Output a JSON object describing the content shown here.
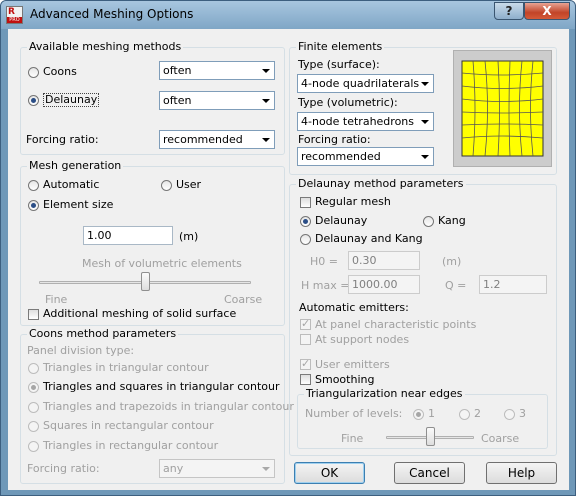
{
  "window": {
    "title": "Advanced Meshing Options",
    "help_button": "?",
    "close_button": "X"
  },
  "app_icon": {
    "letter": "R",
    "brand": "PRO"
  },
  "meshing_methods": {
    "legend": "Available meshing methods",
    "coons": {
      "label": "Coons",
      "selected": false,
      "value": "often"
    },
    "delaunay": {
      "label": "Delaunay",
      "selected": true,
      "value": "often"
    },
    "forcing_ratio": {
      "label": "Forcing ratio:",
      "value": "recommended"
    }
  },
  "finite_elements": {
    "legend": "Finite elements",
    "surface_label": "Type (surface):",
    "surface_value": "4-node quadrilaterals",
    "volumetric_label": "Type (volumetric):",
    "volumetric_value": "4-node tetrahedrons",
    "forcing_label": "Forcing ratio:",
    "forcing_value": "recommended",
    "preview": {
      "fill_color": "#ffff00",
      "background": "#cccccc"
    }
  },
  "mesh_generation": {
    "legend": "Mesh generation",
    "automatic": {
      "label": "Automatic",
      "selected": false
    },
    "user": {
      "label": "User",
      "selected": false
    },
    "element_size": {
      "label": "Element size",
      "selected": true
    },
    "size_value": "1.00",
    "size_unit": "(m)",
    "volumetric_label": "Mesh of volumetric elements",
    "fine_label": "Fine",
    "coarse_label": "Coarse",
    "slider_level": 0.5,
    "additional": {
      "label": "Additional meshing of solid surface",
      "checked": false
    }
  },
  "coons_params": {
    "legend": "Coons method parameters",
    "division_label": "Panel division type:",
    "options": [
      {
        "label": "Triangles in triangular contour",
        "selected": false
      },
      {
        "label": "Triangles and squares in triangular contour",
        "selected": true
      },
      {
        "label": "Triangles and trapezoids in triangular contour",
        "selected": false
      },
      {
        "label": "Squares in rectangular contour",
        "selected": false
      },
      {
        "label": "Triangles in rectangular contour",
        "selected": false
      }
    ],
    "forcing_label": "Forcing ratio:",
    "forcing_value": "any"
  },
  "delaunay_params": {
    "legend": "Delaunay method parameters",
    "regular_mesh": {
      "label": "Regular mesh",
      "checked": false
    },
    "delaunay": {
      "label": "Delaunay",
      "selected": true
    },
    "kang": {
      "label": "Kang",
      "selected": false
    },
    "delaunay_kang": {
      "label": "Delaunay and Kang",
      "selected": false
    },
    "h0_label": "H0 =",
    "h0_value": "0.30",
    "h0_unit": "(m)",
    "hmax_label": "H max =",
    "hmax_value": "1000.00",
    "q_label": "Q =",
    "q_value": "1.2",
    "emitters_label": "Automatic emitters:",
    "panel_points": {
      "label": "At panel characteristic points",
      "checked": true
    },
    "support_nodes": {
      "label": "At support nodes",
      "checked": false
    },
    "user_emitters": {
      "label": "User emitters",
      "checked": true
    },
    "smoothing": {
      "label": "Smoothing",
      "checked": false
    }
  },
  "triangularization": {
    "legend": "Triangularization near edges",
    "levels_label": "Number of levels:",
    "levels": [
      "1",
      "2",
      "3"
    ],
    "selected_level": "1",
    "fine_label": "Fine",
    "coarse_label": "Coarse",
    "slider_level": 0.5
  },
  "buttons": {
    "ok": "OK",
    "cancel": "Cancel",
    "help": "Help"
  }
}
